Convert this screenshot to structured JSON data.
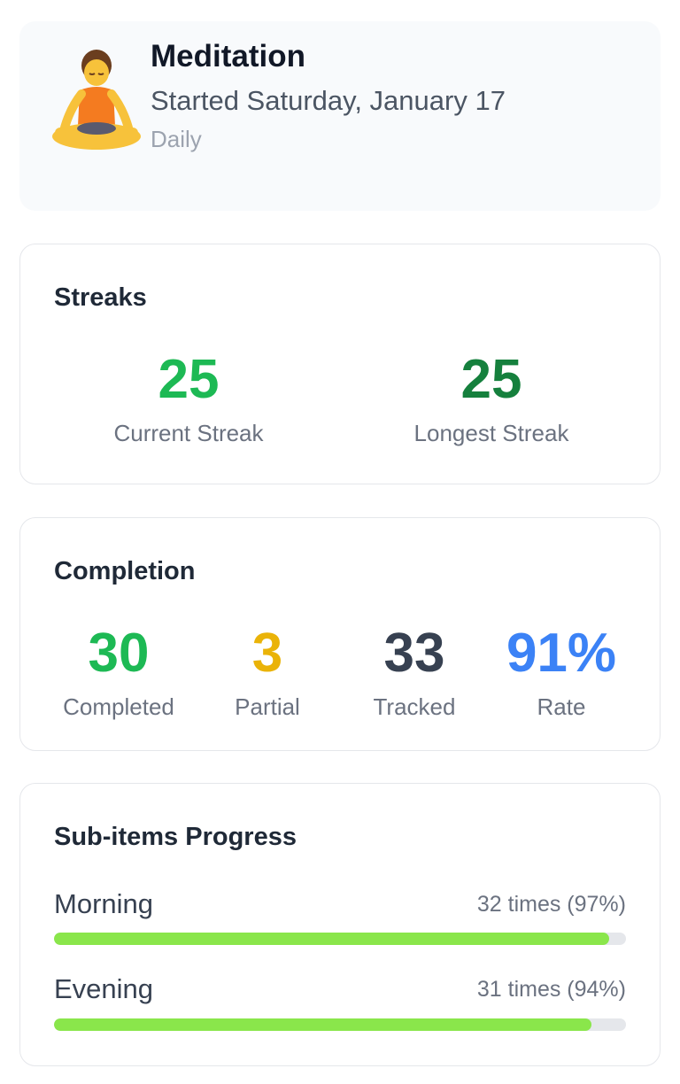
{
  "habit": {
    "icon": "person-meditating-icon",
    "title": "Meditation",
    "started": "Started Saturday, January 17",
    "frequency": "Daily"
  },
  "streaks": {
    "title": "Streaks",
    "current_value": "25",
    "current_label": "Current Streak",
    "current_color": "#1db954",
    "longest_value": "25",
    "longest_label": "Longest Streak",
    "longest_color": "#15803d"
  },
  "completion": {
    "title": "Completion",
    "stats": [
      {
        "value": "30",
        "label": "Completed",
        "color": "#1db954"
      },
      {
        "value": "3",
        "label": "Partial",
        "color": "#eab308"
      },
      {
        "value": "33",
        "label": "Tracked",
        "color": "#374151"
      },
      {
        "value": "91%",
        "label": "Rate",
        "color": "#3b82f6"
      }
    ]
  },
  "subitems": {
    "title": "Sub-items Progress",
    "bar_color": "#8ae64b",
    "items": [
      {
        "name": "Morning",
        "count": "32 times (97%)",
        "progress": 0.97
      },
      {
        "name": "Evening",
        "count": "31 times (94%)",
        "progress": 0.94
      }
    ]
  }
}
